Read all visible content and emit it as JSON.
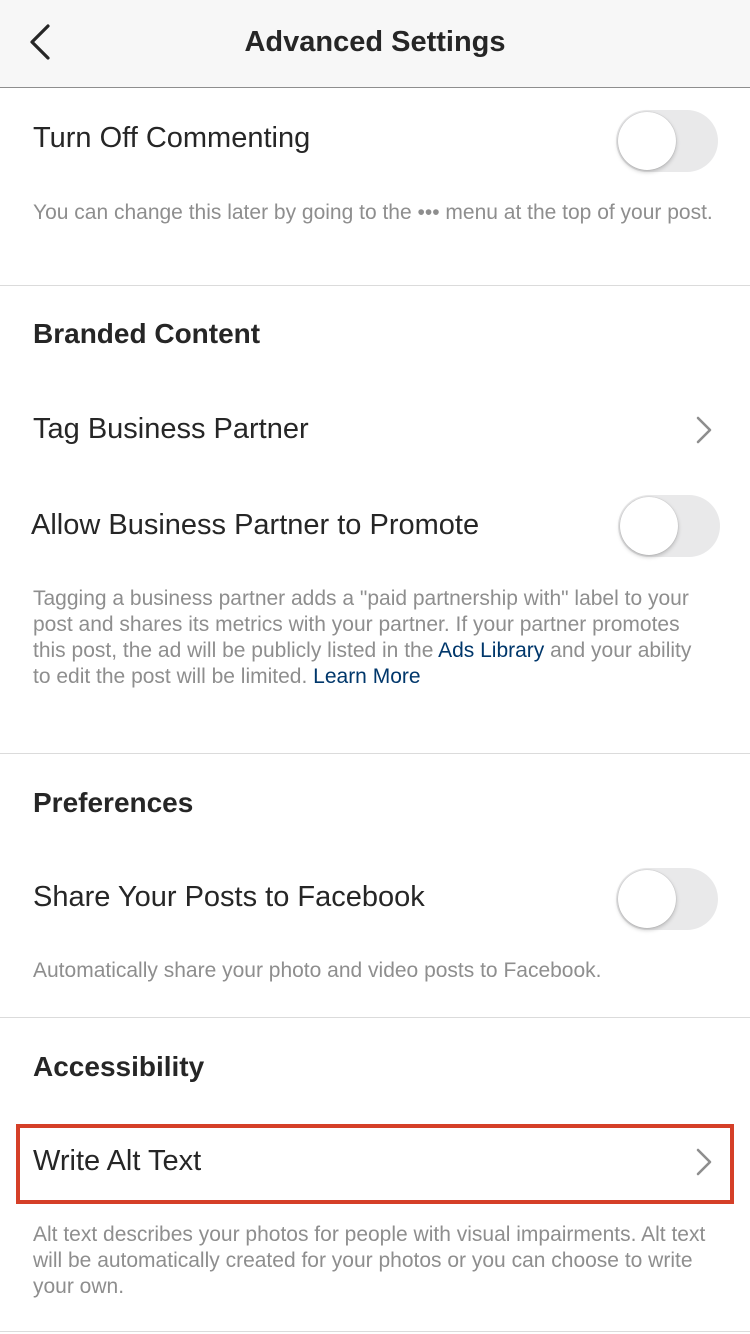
{
  "nav": {
    "title": "Advanced Settings",
    "back_icon": "chevron-left-icon"
  },
  "commenting": {
    "label": "Turn Off Commenting",
    "toggle_on": false,
    "desc_before": "You can change this later by going to the",
    "desc_icon": "•••",
    "desc_after": "menu at the top of your post."
  },
  "branded": {
    "heading": "Branded Content",
    "tag_partner_label": "Tag Business Partner",
    "allow_promote_label": "Allow Business Partner to Promote",
    "allow_promote_on": false,
    "desc_part1": "Tagging a business partner adds a \"paid partnership with\" label to your post and shares its metrics with your partner. If your partner promotes this post, the ad will be publicly listed in the",
    "ads_library_link": "Ads Library",
    "desc_part2": "and your ability to edit the post will be limited.",
    "learn_more_link": "Learn More"
  },
  "preferences": {
    "heading": "Preferences",
    "share_facebook_label": "Share Your Posts to Facebook",
    "share_facebook_on": false,
    "desc": "Automatically share your photo and video posts to Facebook."
  },
  "accessibility": {
    "heading": "Accessibility",
    "alt_text_label": "Write Alt Text",
    "desc": "Alt text describes your photos for people with visual impairments. Alt text will be automatically created for your photos or you can choose to write your own."
  },
  "colors": {
    "highlight": "#d53f28",
    "link": "#00376b",
    "secondary_text": "#8e8e8e",
    "toggle_off": "#e9e9ea"
  }
}
